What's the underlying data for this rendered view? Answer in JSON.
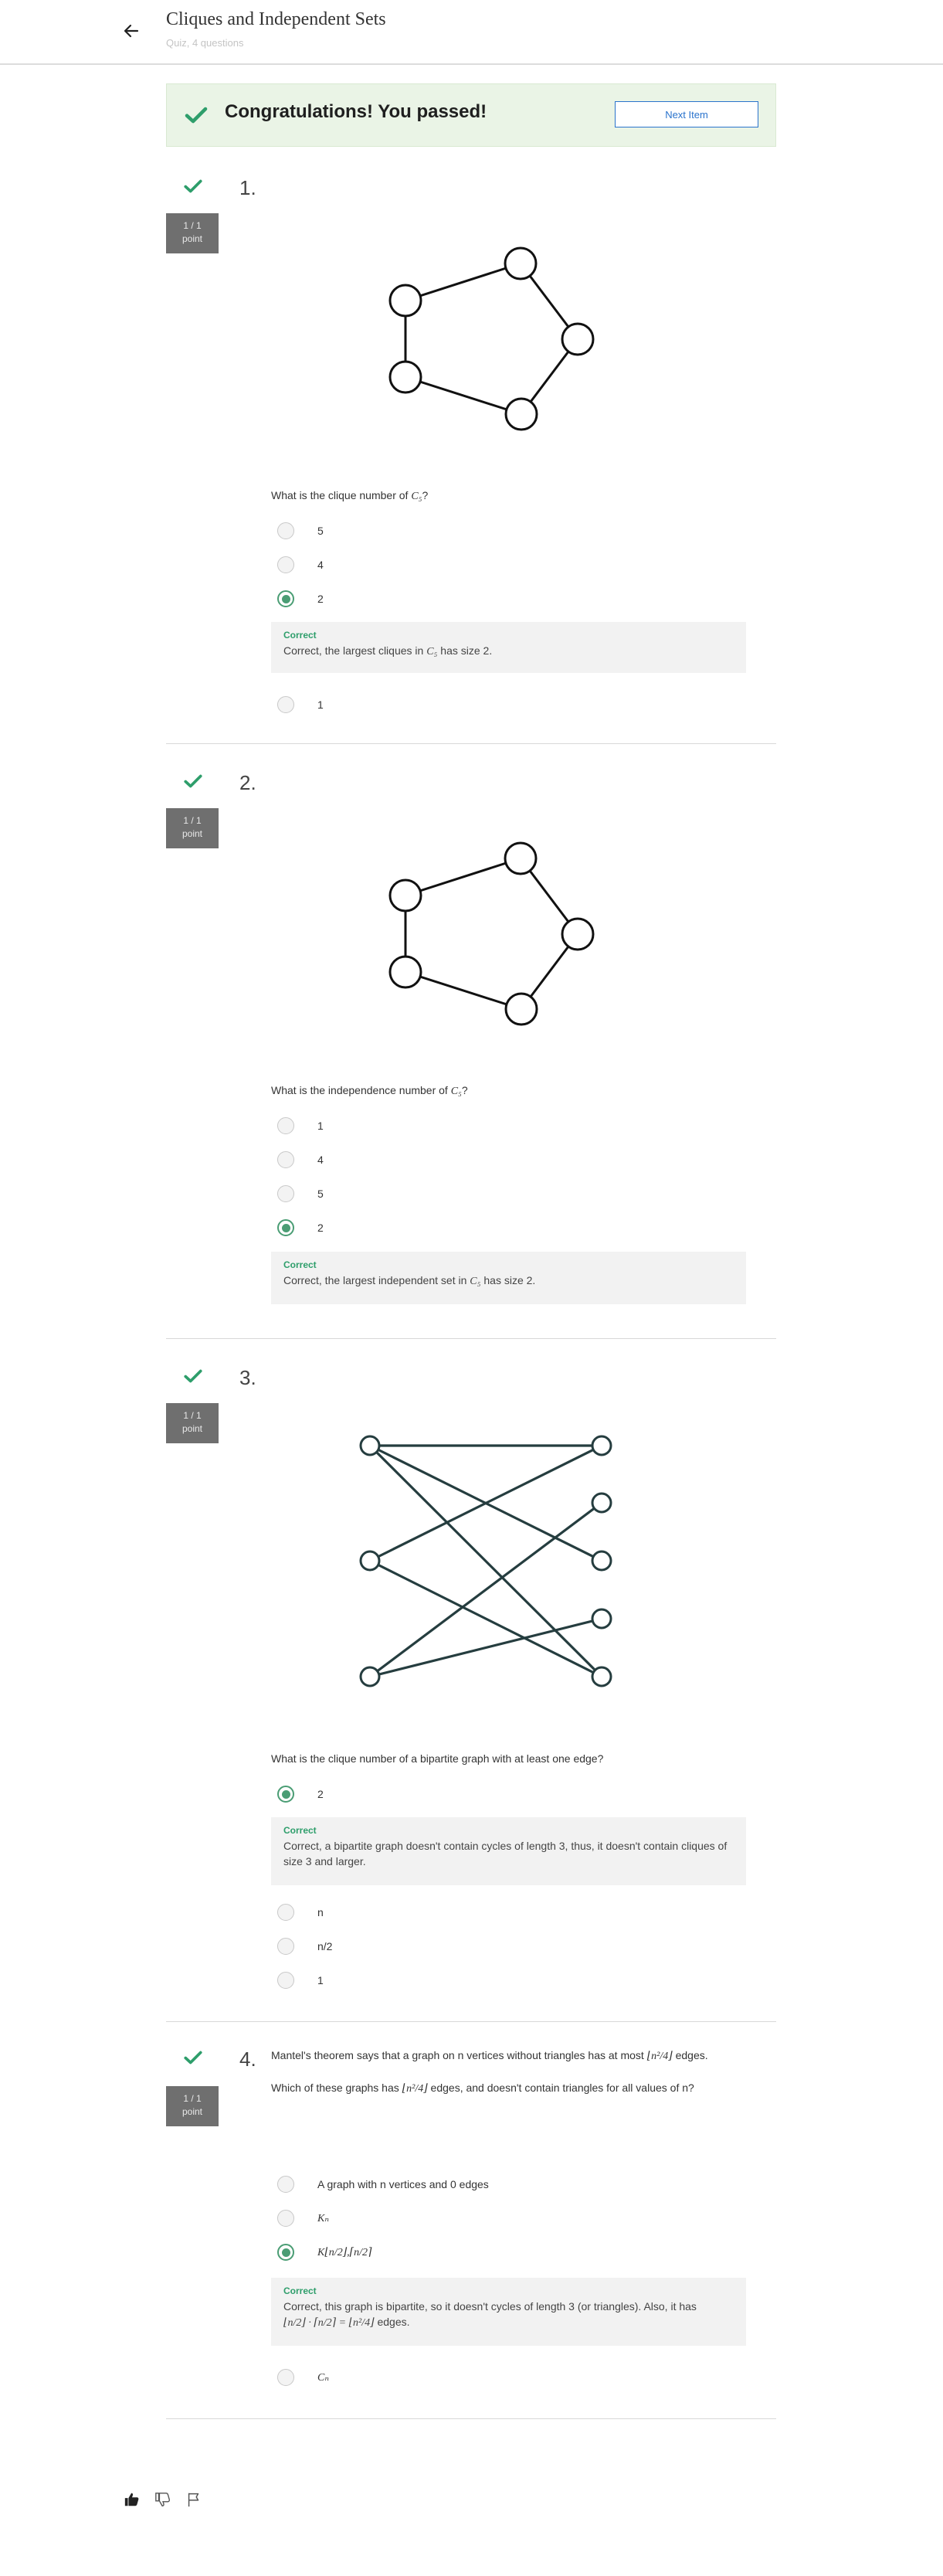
{
  "header": {
    "title": "Cliques and Independent Sets",
    "subtitle": "Quiz, 4 questions"
  },
  "banner": {
    "message": "Congratulations! You passed!",
    "next_label": "Next Item"
  },
  "questions": [
    {
      "number": "1.",
      "score_line1": "1 / 1",
      "score_line2": "point",
      "prompt_before": "What is the clique number of ",
      "prompt_math": "C₅",
      "prompt_after": "?",
      "options": [
        "5",
        "4",
        "2",
        "1"
      ],
      "selected": "2",
      "feedback_title": "Correct",
      "feedback_before": "Correct, the largest cliques in ",
      "feedback_math": "C₅",
      "feedback_after": " has size 2."
    },
    {
      "number": "2.",
      "score_line1": "1 / 1",
      "score_line2": "point",
      "prompt_before": "What is the independence number of ",
      "prompt_math": "C₅",
      "prompt_after": "?",
      "options": [
        "1",
        "4",
        "5",
        "2"
      ],
      "selected": "2",
      "feedback_title": "Correct",
      "feedback_before": "Correct, the largest independent set in ",
      "feedback_math": "C₅",
      "feedback_after": " has size 2."
    },
    {
      "number": "3.",
      "score_line1": "1 / 1",
      "score_line2": "point",
      "prompt": "What is the clique number of a bipartite graph with at least one edge?",
      "options": [
        "2",
        "n",
        "n/2",
        "1"
      ],
      "selected": "2",
      "feedback_title": "Correct",
      "feedback_text": "Correct, a bipartite graph doesn't contain cycles of length 3, thus, it doesn't contain cliques of size 3 and larger."
    },
    {
      "number": "4.",
      "score_line1": "1 / 1",
      "score_line2": "point",
      "prompt1_before": "Mantel's theorem says that a graph on n vertices without triangles has at most ",
      "prompt1_math": "⌊n²/4⌋",
      "prompt1_after": " edges.",
      "prompt2_before": "Which of these graphs has ",
      "prompt2_math": "⌊n²/4⌋",
      "prompt2_after": " edges, and doesn't contain triangles for all values of n?",
      "options": [
        "A graph with n vertices and 0 edges",
        "Kₙ",
        "K⌊n/2⌋,⌈n/2⌉",
        "Cₙ"
      ],
      "selected": "K⌊n/2⌋,⌈n/2⌉",
      "feedback_title": "Correct",
      "feedback_line1": "Correct, this graph is bipartite, so it doesn't cycles of length 3 (or triangles). Also, it has",
      "feedback_line2_math": "⌊n/2⌋ · ⌈n/2⌉ = ⌊n²/4⌋",
      "feedback_line2_after": " edges."
    }
  ],
  "colors": {
    "success": "#2e9e6b",
    "link": "#2a73cc",
    "score_bg": "#6f6f6f",
    "banner_bg": "#eaf4e6"
  },
  "footer_icons": [
    "thumbs-up-icon",
    "thumbs-down-icon",
    "flag-icon"
  ]
}
